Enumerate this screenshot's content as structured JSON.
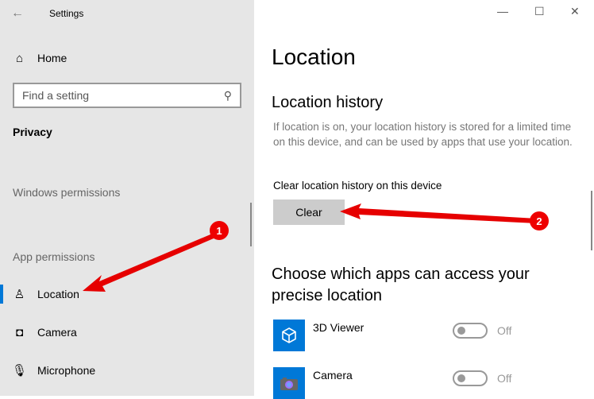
{
  "window": {
    "title": "Settings",
    "minimize": "—",
    "maximize": "☐",
    "close": "✕"
  },
  "sidebar": {
    "home": "Home",
    "search_placeholder": "Find a setting",
    "category": "Privacy",
    "windows_permissions": "Windows permissions",
    "app_permissions": "App permissions",
    "items": [
      {
        "label": "Location",
        "selected": true
      },
      {
        "label": "Camera"
      },
      {
        "label": "Microphone"
      }
    ]
  },
  "main": {
    "title": "Location",
    "history_heading": "Location history",
    "history_desc": "If location is on, your location history is stored for a limited time on this device, and can be used by apps that use your location.",
    "clear_label": "Clear location history on this device",
    "clear_button": "Clear",
    "apps_heading": "Choose which apps can access your precise location",
    "apps": [
      {
        "name": "3D Viewer",
        "state": "Off",
        "on": false
      },
      {
        "name": "Camera",
        "state": "Off",
        "on": false
      }
    ]
  },
  "annotations": [
    "1",
    "2"
  ],
  "colors": {
    "accent": "#0078d7",
    "arrow": "#e60000"
  }
}
